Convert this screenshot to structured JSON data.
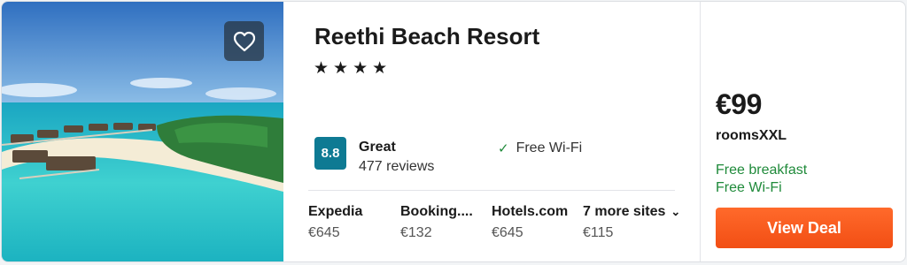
{
  "hotel": {
    "name": "Reethi Beach Resort",
    "stars": "★★★★",
    "rating": {
      "score": "8.8",
      "label": "Great",
      "reviews": "477 reviews"
    },
    "amenity": "Free Wi-Fi"
  },
  "sites": [
    {
      "name": "Expedia",
      "price": "€645"
    },
    {
      "name": "Booking....",
      "price": "€132"
    },
    {
      "name": "Hotels.com",
      "price": "€645"
    },
    {
      "name": "7 more sites",
      "price": "€115"
    }
  ],
  "deal": {
    "price": "€99",
    "provider": "roomsXXL",
    "perks": [
      "Free breakfast",
      "Free Wi-Fi"
    ],
    "button_label": "View Deal"
  },
  "colors": {
    "rating_badge": "#0e7a93",
    "perk_green": "#1f8a3a",
    "cta_orange": "#f24e14"
  },
  "icons": {
    "favorite": "heart-outline-icon",
    "amenity_check": "check-icon",
    "more_sites": "chevron-down-icon"
  }
}
